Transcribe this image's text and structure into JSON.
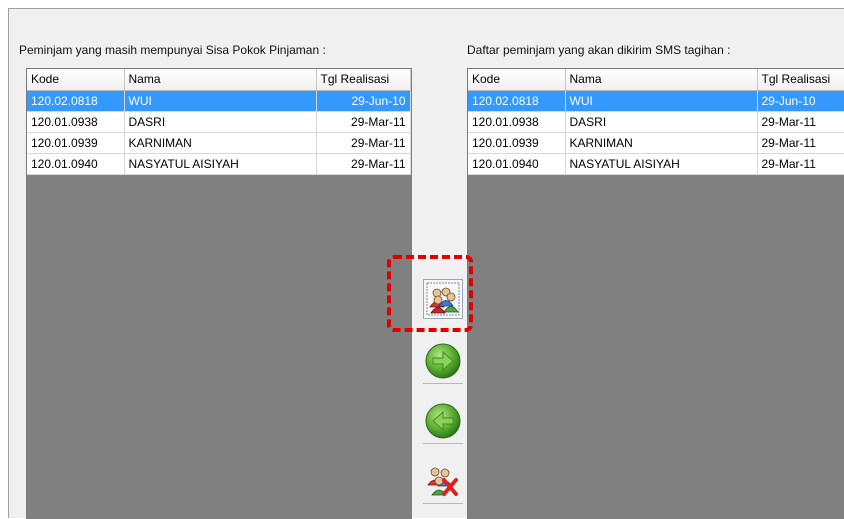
{
  "left_panel": {
    "caption": "Peminjam yang masih mempunyai Sisa Pokok Pinjaman :",
    "columns": [
      "Kode",
      "Nama",
      "Tgl Realisasi"
    ],
    "rows": [
      {
        "kode": "120.02.0818",
        "nama": "WUI",
        "tgl": "29-Jun-10"
      },
      {
        "kode": "120.01.0938",
        "nama": "DASRI",
        "tgl": "29-Mar-11"
      },
      {
        "kode": "120.01.0939",
        "nama": "KARNIMAN",
        "tgl": "29-Mar-11"
      },
      {
        "kode": "120.01.0940",
        "nama": "NASYATUL AISIYAH",
        "tgl": "29-Mar-11"
      }
    ]
  },
  "right_panel": {
    "caption": "Daftar peminjam yang akan dikirim SMS tagihan :",
    "columns": [
      "Kode",
      "Nama",
      "Tgl Realisasi"
    ],
    "rows": [
      {
        "kode": "120.02.0818",
        "nama": "WUI",
        "tgl": "29-Jun-10"
      },
      {
        "kode": "120.01.0938",
        "nama": "DASRI",
        "tgl": "29-Mar-11"
      },
      {
        "kode": "120.01.0939",
        "nama": "KARNIMAN",
        "tgl": "29-Mar-11"
      },
      {
        "kode": "120.01.0940",
        "nama": "NASYATUL AISIYAH",
        "tgl": "29-Mar-11"
      }
    ]
  },
  "buttons": [
    {
      "name": "select-all-users-button",
      "icon": "group-users-icon"
    },
    {
      "name": "move-right-button",
      "icon": "green-arrow-right-icon"
    },
    {
      "name": "move-left-button",
      "icon": "green-arrow-left-icon"
    },
    {
      "name": "remove-all-users-button",
      "icon": "users-delete-icon"
    }
  ],
  "colors": {
    "selection": "#3399ff",
    "highlight": "#e10000",
    "grid_empty": "#808080",
    "window": "#f0f0f0"
  }
}
